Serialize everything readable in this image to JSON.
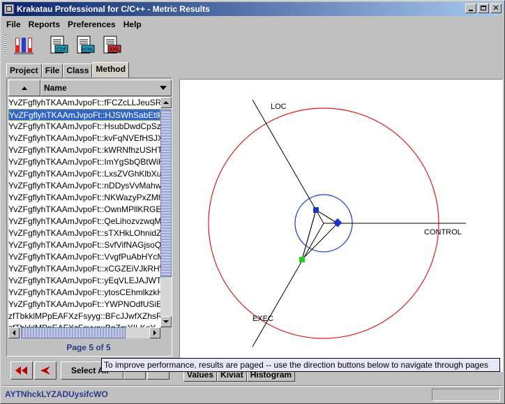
{
  "window": {
    "title": "Krakatau Professional for C/C++ - Metric Results",
    "minimize_label": "_",
    "maximize_label": "□",
    "close_label": "✕"
  },
  "menu": [
    {
      "label": "File"
    },
    {
      "label": "Reports"
    },
    {
      "label": "Preferences"
    },
    {
      "label": "Help"
    }
  ],
  "toolbar": {
    "buttons": [
      {
        "icon": "metrics-thermometer-icon"
      },
      {
        "icon": "report-cdf-icon",
        "text": "CDF"
      },
      {
        "icon": "report-html-icon",
        "text": "HTML"
      },
      {
        "icon": "report-xml-icon",
        "text": "XML"
      }
    ]
  },
  "tabs": [
    {
      "label": "Project",
      "active": false
    },
    {
      "label": "File",
      "active": false
    },
    {
      "label": "Class",
      "active": false
    },
    {
      "label": "Method",
      "active": true
    }
  ],
  "list": {
    "name_header": "Name",
    "rows": [
      "YvZFgflyhTKAAmJvpoFt::fFCZcLLJeuSRi",
      "YvZFgflyhTKAAmJvpoFt::HJSWhSabEtlkE",
      "YvZFgflyhTKAAmJvpoFt::HsubDwdCpSzl",
      "YvZFgflyhTKAAmJvpoFt::kvFqNVEfHSJXr",
      "YvZFgflyhTKAAmJvpoFt::kWRNfhzUSHTb",
      "YvZFgflyhTKAAmJvpoFt::ImYgSbQBtWiKj",
      "YvZFgflyhTKAAmJvpoFt::LxsZVGhKlbXud",
      "YvZFgflyhTKAAmJvpoFt::nDDysVvMahwA",
      "YvZFgflyhTKAAmJvpoFt::NKWazyPxZMhT",
      "YvZFgflyhTKAAmJvpoFt::OwnMPllKRGEa",
      "YvZFgflyhTKAAmJvpoFt::QeLihozvzwqMq",
      "YvZFgflyhTKAAmJvpoFt::sTXHkLOhnidZr",
      "YvZFgflyhTKAAmJvpoFt::SvfVifNAGjsoQB",
      "YvZFgflyhTKAAmJvpoFt::VvgfPuAbHYcMv",
      "YvZFgflyhTKAAmJvpoFt::xCGZEiVJkRHW",
      "YvZFgflyhTKAAmJvpoFt::yEqVLEJAJWTfC",
      "YvZFgflyhTKAAmJvpoFt::ytosCEhmlkzkH",
      "YvZFgflyhTKAAmJvpoFt::YWPNOdfUSiEu",
      "zfTbkklMPpEAFXzFsyyg::BFcJJwfXZhsRu",
      "zfTbkklMPpEAFXzFsyyg::BqZmYILKqY"
    ],
    "selected_index": 1
  },
  "paging": {
    "page_text": "Page 5 of 5",
    "select_all_label": "Select All"
  },
  "chart": {
    "labels": {
      "loc": "LOC",
      "control": "CONTROL",
      "exec": "EXEC"
    },
    "colors": {
      "outer_circle": "#d81e1e",
      "inner_circle": "#1a34c8",
      "axes": "#000000",
      "point_loc": "#1a34c8",
      "point_control": "#1a34c8",
      "point_exec": "#22d022"
    }
  },
  "bottom_tabs": [
    {
      "label": "Values"
    },
    {
      "label": "Kiviat"
    },
    {
      "label": "Histogram"
    }
  ],
  "tooltip": "To improve performance, results are paged -- use the direction buttons below to navigate through pages",
  "status": {
    "left_text": "AYTNhckLYZADUysifcWO"
  }
}
